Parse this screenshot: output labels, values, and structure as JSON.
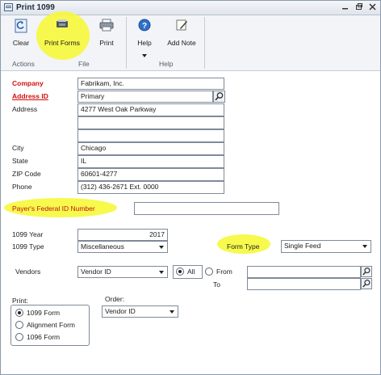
{
  "window": {
    "title": "Print 1099"
  },
  "ribbon": {
    "groups": [
      {
        "label": "Actions"
      },
      {
        "label": "File"
      },
      {
        "label": "Help"
      }
    ],
    "buttons": {
      "clear": "Clear",
      "print_forms": "Print Forms",
      "print": "Print",
      "help": "Help",
      "add_note": "Add Note"
    }
  },
  "form": {
    "company": {
      "label": "Company",
      "value": "Fabrikam, Inc."
    },
    "address_id": {
      "label": "Address ID",
      "value": "Primary"
    },
    "address": {
      "label": "Address",
      "lines": [
        "4277 West Oak Parkway",
        "",
        ""
      ]
    },
    "city": {
      "label": "City",
      "value": "Chicago"
    },
    "state": {
      "label": "State",
      "value": "IL"
    },
    "zip": {
      "label": "ZIP Code",
      "value": "60601-4277"
    },
    "phone": {
      "label": "Phone",
      "value": "(312) 436-2671  Ext. 0000"
    },
    "payer_id": {
      "label": "Payer's Federal ID Number",
      "value": ""
    },
    "year": {
      "label": "1099 Year",
      "value": "2017"
    },
    "type": {
      "label": "1099 Type",
      "value": "Miscellaneous"
    },
    "form_type": {
      "label": "Form Type",
      "value": "Single Feed"
    },
    "vendors": {
      "label": "Vendors",
      "value": "Vendor ID",
      "all": "All",
      "from": "From",
      "to": "To",
      "from_value": "",
      "to_value": ""
    },
    "print": {
      "label": "Print:",
      "options": [
        "1099 Form",
        "Alignment Form",
        "1096 Form"
      ],
      "selected": "1099 Form"
    },
    "order": {
      "label": "Order:",
      "value": "Vendor ID"
    }
  },
  "colors": {
    "highlight": "#f6f83a",
    "required": "#d01010"
  }
}
